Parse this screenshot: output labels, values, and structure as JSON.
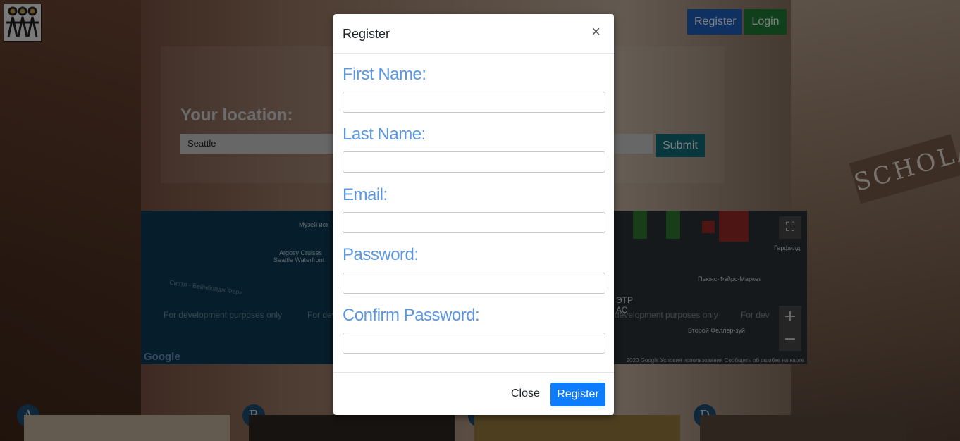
{
  "header": {
    "logo_icon": "people-logo-icon",
    "register_label": "Register",
    "login_label": "Login"
  },
  "location": {
    "label": "Your location:",
    "value": "Seattle",
    "submit_label": "Submit"
  },
  "map": {
    "dev_text": "For development purposes only",
    "dev_text_short": "For dev",
    "dev_text_partial": "development purposes only",
    "dev_text_right": "For dev",
    "labels": [
      "Музей иск",
      "Argosy Cruises",
      "Seattle Waterfront",
      "Сиэтл - Бейнбридж Фери",
      "Гарфилд",
      "Второй Феллер-зуй",
      "Пьюнс-Фэйрс-Маркет",
      "ЭТР",
      "АС"
    ],
    "google_label": "Google",
    "footer": "2020 Google   Условия использования   Сообщить об ошибке на карте",
    "zoom_in": "+",
    "zoom_out": "−",
    "fullscreen_icon": "fullscreen-icon"
  },
  "markers": [
    "A",
    "B",
    "C",
    "D"
  ],
  "modal": {
    "title": "Register",
    "close_icon": "×",
    "fields": [
      {
        "label": "First Name:",
        "value": ""
      },
      {
        "label": "Last Name:",
        "value": ""
      },
      {
        "label": "Email:",
        "value": ""
      },
      {
        "label": "Password:",
        "value": ""
      },
      {
        "label": "Confirm Password:",
        "value": ""
      }
    ],
    "close_label": "Close",
    "register_label": "Register"
  },
  "colors": {
    "register_blue": "#0d7cff",
    "label_blue": "#5b96e0",
    "login_green": "#1e7f36",
    "submit_teal": "#11717c"
  }
}
